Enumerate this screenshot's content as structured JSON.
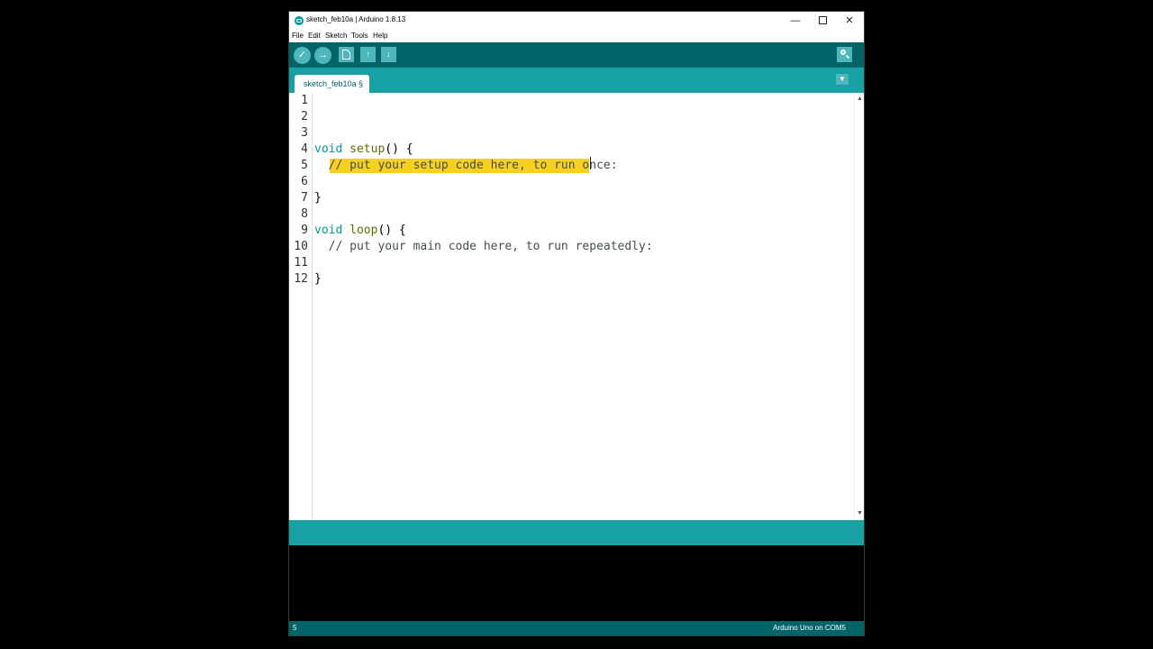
{
  "window": {
    "title": "sketch_feb10a | Arduino 1.8.13",
    "controls": {
      "minimize": "—",
      "close": "✕"
    }
  },
  "menu": {
    "items": [
      "File",
      "Edit",
      "Sketch",
      "Tools",
      "Help"
    ]
  },
  "toolbar": {
    "verify_icon": "✓",
    "upload_icon": "→",
    "new_icon": "new-file-icon",
    "open_icon": "↑",
    "save_icon": "↓",
    "serial_icon": "magnifier-icon"
  },
  "tabs": {
    "active_label": "sketch_feb10a §",
    "menu_icon": "▼"
  },
  "editor": {
    "line_numbers": [
      "1",
      "2",
      "3",
      "4",
      "5",
      "6",
      "7",
      "8",
      "9",
      "10",
      "11",
      "12"
    ],
    "lines": {
      "l4_type": "void",
      "l4_func": "setup",
      "l4_rest": "() {",
      "l5_comment": "  // put your setup code here, to run once:",
      "l7": "}",
      "l9_type": "void",
      "l9_func": "loop",
      "l9_rest": "() {",
      "l10_comment": "  // put your main code here, to run repeatedly:",
      "l12": "}"
    },
    "selected_text": "// put your setup code here, to r"
  },
  "footer": {
    "line_number": "5",
    "board": "Arduino Uno on COM5"
  },
  "colors": {
    "toolbar": "#006468",
    "tabbar": "#17a1a5",
    "keyword": "#00979c",
    "function": "#5e6d03",
    "highlight": "#f7d020"
  }
}
